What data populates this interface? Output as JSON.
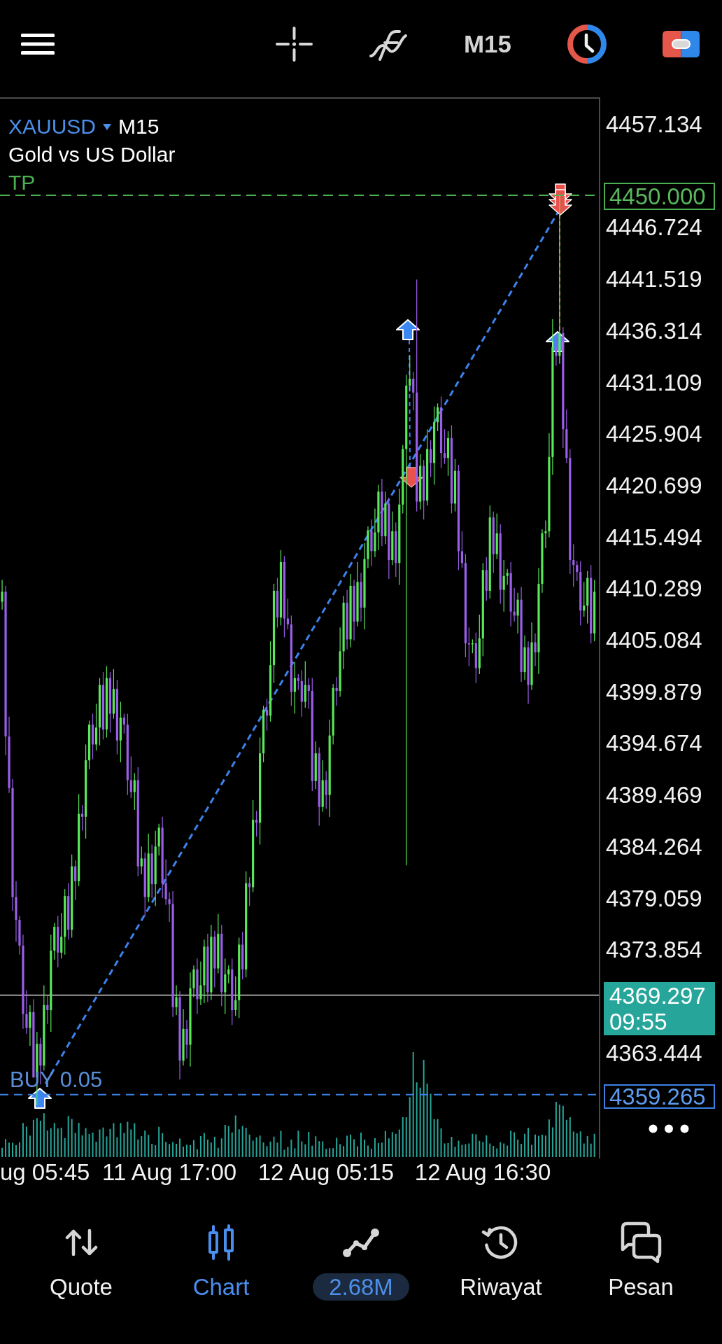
{
  "top_bar": {
    "timeframe": "M15"
  },
  "chart": {
    "symbol": "XAUUSD",
    "timeframe": "M15",
    "description": "Gold vs US Dollar",
    "take_profit_label": "TP",
    "take_profit_tag": "4450.000",
    "current_price_tag": {
      "price": "4369.297",
      "countdown": "09:55"
    },
    "order": {
      "label": "BUY 0.05",
      "price_tag": "4359.265"
    },
    "clipped_time_label": "ug 05:45",
    "chart_data": {
      "type": "candlestick",
      "categories": [
        null,
        null,
        null,
        null,
        null,
        null,
        null,
        null,
        null,
        null,
        null,
        null,
        null,
        null,
        null,
        null,
        null,
        null,
        null,
        null,
        null,
        null,
        null,
        null,
        null,
        null,
        null,
        null,
        null,
        null,
        null,
        null,
        null,
        null,
        null,
        null,
        null,
        null,
        null,
        null,
        null,
        null,
        null,
        null,
        null,
        null,
        null,
        null,
        "11 Aug 17:00",
        null,
        null,
        null,
        null,
        null,
        null,
        null,
        null,
        null,
        null,
        null,
        null,
        null,
        null,
        null,
        null,
        null,
        null,
        null,
        null,
        null,
        null,
        null,
        null,
        null,
        null,
        null,
        null,
        null,
        null,
        null,
        null,
        null,
        null,
        null,
        null,
        null,
        null,
        null,
        null,
        null,
        null,
        null,
        null,
        "12 Aug 05:15",
        null,
        null,
        null,
        null,
        null,
        null,
        null,
        null,
        null,
        null,
        null,
        null,
        null,
        null,
        null,
        null,
        null,
        null,
        null,
        null,
        null,
        null,
        null,
        null,
        null,
        null,
        null,
        null,
        null,
        null,
        null,
        null,
        null,
        null,
        null,
        null,
        null,
        null,
        null,
        null,
        null,
        null,
        null,
        null,
        "12 Aug 16:30",
        null,
        null,
        null,
        null,
        null,
        null,
        null,
        null,
        null,
        null,
        null,
        null,
        null,
        null,
        null,
        null,
        null,
        null,
        null,
        null,
        null,
        null,
        null,
        null,
        null,
        null,
        null,
        null,
        null,
        null,
        null,
        null
      ],
      "ohlc": [
        [
          4409.0,
          4411.2,
          4408.2,
          4410.0
        ],
        [
          4410.0,
          4410.6,
          4393.5,
          4395.4
        ],
        [
          4395.4,
          4397.4,
          4389.7,
          4390.2
        ],
        [
          4390.2,
          4391.1,
          4377.8,
          4379.2
        ],
        [
          4379.2,
          4380.8,
          4374.7,
          4376.9
        ],
        [
          4376.9,
          4377.3,
          4373.4,
          4374.3
        ],
        [
          4374.3,
          4375.4,
          4365.9,
          4367.4
        ],
        [
          4367.4,
          4369.8,
          4365.4,
          4366.0
        ],
        [
          4366.0,
          4368.3,
          4364.2,
          4367.6
        ],
        [
          4367.6,
          4368.9,
          4361.0,
          4361.0
        ],
        [
          4361.0,
          4365.6,
          4358.2,
          4364.4
        ],
        [
          4364.4,
          4365.0,
          4360.3,
          4362.2
        ],
        [
          4362.2,
          4370.3,
          4361.7,
          4368.3
        ],
        [
          4368.3,
          4369.2,
          4366.4,
          4367.8
        ],
        [
          4367.8,
          4375.4,
          4365.6,
          4373.8
        ],
        [
          4373.8,
          4376.6,
          4372.9,
          4376.2
        ],
        [
          4376.2,
          4377.3,
          4372.1,
          4373.6
        ],
        [
          4373.6,
          4377.6,
          4373.0,
          4375.2
        ],
        [
          4375.2,
          4380.0,
          4373.4,
          4379.3
        ],
        [
          4379.3,
          4380.6,
          4374.9,
          4375.9
        ],
        [
          4375.9,
          4383.5,
          4375.1,
          4382.3
        ],
        [
          4382.3,
          4382.9,
          4378.9,
          4380.8
        ],
        [
          4380.8,
          4389.6,
          4380.3,
          4387.6
        ],
        [
          4387.6,
          4388.5,
          4385.9,
          4387.3
        ],
        [
          4387.3,
          4394.6,
          4385.1,
          4393.0
        ],
        [
          4393.0,
          4397.0,
          4392.1,
          4396.6
        ],
        [
          4396.6,
          4397.7,
          4393.1,
          4394.6
        ],
        [
          4394.6,
          4398.7,
          4394.0,
          4396.3
        ],
        [
          4396.3,
          4401.3,
          4394.5,
          4400.6
        ],
        [
          4400.6,
          4401.9,
          4395.1,
          4396.1
        ],
        [
          4396.1,
          4402.5,
          4395.3,
          4401.3
        ],
        [
          4401.3,
          4401.9,
          4395.8,
          4397.7
        ],
        [
          4397.7,
          4402.2,
          4397.2,
          4400.2
        ],
        [
          4400.2,
          4401.1,
          4393.6,
          4395.0
        ],
        [
          4395.0,
          4398.9,
          4392.8,
          4397.3
        ],
        [
          4397.3,
          4397.7,
          4395.7,
          4396.6
        ],
        [
          4396.6,
          4397.7,
          4389.5,
          4391.0
        ],
        [
          4391.0,
          4393.4,
          4389.2,
          4389.8
        ],
        [
          4389.8,
          4391.7,
          4388.0,
          4391.0
        ],
        [
          4391.0,
          4392.3,
          4381.3,
          4382.3
        ],
        [
          4382.3,
          4384.3,
          4381.5,
          4383.1
        ],
        [
          4383.1,
          4383.7,
          4377.3,
          4379.2
        ],
        [
          4379.2,
          4385.6,
          4378.7,
          4383.6
        ],
        [
          4383.6,
          4384.5,
          4379.1,
          4380.5
        ],
        [
          4380.5,
          4385.9,
          4378.3,
          4384.3
        ],
        [
          4384.3,
          4386.6,
          4383.4,
          4386.2
        ],
        [
          4386.2,
          4387.3,
          4379.1,
          4380.6
        ],
        [
          4380.6,
          4383.0,
          4378.4,
          4379.0
        ],
        [
          4379.0,
          4379.7,
          4376.7,
          4378.5
        ],
        [
          4378.5,
          4379.8,
          4367.1,
          4368.1
        ],
        [
          4368.1,
          4370.3,
          4367.3,
          4369.1
        ],
        [
          4369.1,
          4369.7,
          4360.8,
          4362.7
        ],
        [
          4362.7,
          4367.9,
          4362.2,
          4365.9
        ],
        [
          4365.9,
          4366.8,
          4362.9,
          4364.3
        ],
        [
          4364.3,
          4371.6,
          4362.1,
          4370.0
        ],
        [
          4370.0,
          4372.3,
          4369.1,
          4371.9
        ],
        [
          4371.9,
          4373.0,
          4367.4,
          4368.9
        ],
        [
          4368.9,
          4372.7,
          4368.3,
          4370.3
        ],
        [
          4370.3,
          4374.9,
          4368.5,
          4374.2
        ],
        [
          4374.2,
          4375.5,
          4368.6,
          4369.6
        ],
        [
          4369.6,
          4376.4,
          4368.8,
          4375.2
        ],
        [
          4375.2,
          4375.8,
          4370.1,
          4372.0
        ],
        [
          4372.0,
          4377.5,
          4371.5,
          4375.5
        ],
        [
          4375.5,
          4376.4,
          4368.2,
          4369.6
        ],
        [
          4369.6,
          4373.0,
          4367.4,
          4371.4
        ],
        [
          4371.4,
          4372.3,
          4370.5,
          4371.9
        ],
        [
          4371.9,
          4373.0,
          4366.3,
          4367.8
        ],
        [
          4367.8,
          4371.2,
          4367.2,
          4368.8
        ],
        [
          4368.8,
          4375.1,
          4367.0,
          4374.4
        ],
        [
          4374.4,
          4375.7,
          4370.9,
          4371.9
        ],
        [
          4371.9,
          4381.8,
          4371.1,
          4380.6
        ],
        [
          4380.6,
          4381.2,
          4378.3,
          4380.2
        ],
        [
          4380.2,
          4389.0,
          4379.7,
          4387.0
        ],
        [
          4387.0,
          4387.9,
          4385.3,
          4386.7
        ],
        [
          4386.7,
          4395.3,
          4384.5,
          4393.7
        ],
        [
          4393.7,
          4398.5,
          4392.8,
          4398.1
        ],
        [
          4398.1,
          4399.2,
          4396.0,
          4397.5
        ],
        [
          4397.5,
          4405.0,
          4396.9,
          4402.6
        ],
        [
          4402.6,
          4410.8,
          4400.8,
          4410.1
        ],
        [
          4410.1,
          4411.4,
          4406.4,
          4407.4
        ],
        [
          4407.4,
          4414.2,
          4406.6,
          4413.0
        ],
        [
          4413.0,
          4413.6,
          4405.4,
          4407.3
        ],
        [
          4407.3,
          4409.3,
          4406.2,
          4406.7
        ],
        [
          4406.7,
          4407.6,
          4398.5,
          4399.9
        ],
        [
          4399.9,
          4402.9,
          4397.7,
          4401.3
        ],
        [
          4401.3,
          4401.7,
          4400.1,
          4401.0
        ],
        [
          4401.0,
          4402.1,
          4397.4,
          4398.9
        ],
        [
          4398.9,
          4403.0,
          4398.3,
          4400.6
        ],
        [
          4400.6,
          4401.3,
          4398.2,
          4400.0
        ],
        [
          4400.0,
          4401.3,
          4389.9,
          4390.9
        ],
        [
          4390.9,
          4394.9,
          4390.1,
          4393.7
        ],
        [
          4393.7,
          4394.3,
          4386.4,
          4388.3
        ],
        [
          4388.3,
          4393.0,
          4387.8,
          4391.0
        ],
        [
          4391.0,
          4391.9,
          4388.1,
          4389.5
        ],
        [
          4389.5,
          4397.1,
          4387.3,
          4395.5
        ],
        [
          4395.5,
          4400.7,
          4394.6,
          4400.3
        ],
        [
          4400.3,
          4401.4,
          4398.5,
          4400.0
        ],
        [
          4400.0,
          4406.4,
          4399.4,
          4404.0
        ],
        [
          4404.0,
          4409.6,
          4402.2,
          4408.9
        ],
        [
          4408.9,
          4410.2,
          4404.2,
          4405.2
        ],
        [
          4405.2,
          4411.8,
          4404.4,
          4410.6
        ],
        [
          4410.6,
          4411.2,
          4405.1,
          4407.0
        ],
        [
          4407.0,
          4413.0,
          4406.5,
          4411.0
        ],
        [
          4411.0,
          4411.9,
          4407.0,
          4408.4
        ],
        [
          4408.4,
          4414.9,
          4406.2,
          4413.3
        ],
        [
          4413.3,
          4416.6,
          4412.4,
          4416.2
        ],
        [
          4416.2,
          4417.3,
          4412.6,
          4414.1
        ],
        [
          4414.1,
          4418.4,
          4413.5,
          4416.0
        ],
        [
          4416.0,
          4420.8,
          4414.2,
          4420.1
        ],
        [
          4420.1,
          4421.4,
          4414.6,
          4415.6
        ],
        [
          4415.6,
          4420.1,
          4414.8,
          4418.9
        ],
        [
          4418.9,
          4419.5,
          4411.3,
          4413.2
        ],
        [
          4413.2,
          4418.1,
          4412.7,
          4416.1
        ],
        [
          4416.1,
          4417.0,
          4411.5,
          4412.9
        ],
        [
          4412.9,
          4420.4,
          4410.7,
          4418.8
        ],
        [
          4418.8,
          4424.8,
          4417.9,
          4424.4
        ],
        [
          4424.4,
          4431.9,
          4382.4,
          4430.8
        ],
        [
          4430.8,
          4433.9,
          4430.2,
          4431.5
        ],
        [
          4431.5,
          4432.2,
          4428.3,
          4430.1
        ],
        [
          4430.1,
          4441.5,
          4418.1,
          4419.1
        ],
        [
          4419.1,
          4423.9,
          4418.3,
          4422.7
        ],
        [
          4422.7,
          4423.3,
          4417.3,
          4419.2
        ],
        [
          4419.2,
          4426.4,
          4418.7,
          4424.4
        ],
        [
          4424.4,
          4425.3,
          4421.6,
          4423.0
        ],
        [
          4423.0,
          4428.7,
          4420.8,
          4427.1
        ],
        [
          4427.1,
          4429.0,
          4426.2,
          4428.6
        ],
        [
          4428.6,
          4429.7,
          4422.5,
          4424.0
        ],
        [
          4424.0,
          4426.4,
          4422.9,
          4423.5
        ],
        [
          4423.5,
          4426.2,
          4421.7,
          4425.5
        ],
        [
          4425.5,
          4426.8,
          4417.9,
          4418.9
        ],
        [
          4418.9,
          4423.4,
          4418.1,
          4422.2
        ],
        [
          4422.2,
          4422.8,
          4412.2,
          4414.1
        ],
        [
          4414.1,
          4416.1,
          4412.4,
          4412.9
        ],
        [
          4412.9,
          4413.8,
          4403.4,
          4404.8
        ],
        [
          4404.8,
          4406.4,
          4402.5,
          4404.7
        ],
        [
          4404.7,
          4405.2,
          4403.8,
          4404.8
        ],
        [
          4404.8,
          4405.9,
          4400.8,
          4402.3
        ],
        [
          4402.3,
          4407.7,
          4401.7,
          4405.3
        ],
        [
          4405.3,
          4412.9,
          4403.5,
          4412.2
        ],
        [
          4412.2,
          4413.5,
          4409.1,
          4410.1
        ],
        [
          4410.1,
          4418.7,
          4409.3,
          4417.5
        ],
        [
          4417.5,
          4418.1,
          4411.9,
          4413.8
        ],
        [
          4413.8,
          4417.9,
          4413.3,
          4415.9
        ],
        [
          4415.9,
          4416.8,
          4408.8,
          4410.2
        ],
        [
          4410.2,
          4413.2,
          4408.0,
          4411.6
        ],
        [
          4411.6,
          4412.3,
          4410.7,
          4411.9
        ],
        [
          4411.9,
          4413.0,
          4406.5,
          4408.0
        ],
        [
          4408.0,
          4410.4,
          4407.0,
          4407.6
        ],
        [
          4407.6,
          4409.9,
          4405.8,
          4409.2
        ],
        [
          4409.2,
          4410.5,
          4400.9,
          4401.9
        ],
        [
          4401.9,
          4405.6,
          4401.1,
          4404.4
        ],
        [
          4404.4,
          4405.0,
          4398.7,
          4400.6
        ],
        [
          4400.6,
          4406.9,
          4400.1,
          4404.9
        ],
        [
          4404.9,
          4405.8,
          4402.5,
          4403.9
        ],
        [
          4403.9,
          4412.4,
          4401.7,
          4410.8
        ],
        [
          4410.8,
          4416.3,
          4409.9,
          4415.9
        ],
        [
          4415.9,
          4417.2,
          4414.4,
          4416.1
        ],
        [
          4416.1,
          4426.0,
          4415.5,
          4423.6
        ],
        [
          4423.6,
          4437.5,
          4421.8,
          4434.7
        ],
        [
          4434.7,
          4436.0,
          4432.8,
          4433.8
        ],
        [
          4433.8,
          4450.0,
          4433.0,
          4436.1
        ],
        [
          4436.1,
          4436.7,
          4424.5,
          4426.4
        ],
        [
          4426.4,
          4428.4,
          4423.0,
          4423.5
        ],
        [
          4423.5,
          4424.4,
          4411.8,
          4413.2
        ],
        [
          4413.2,
          4414.8,
          4410.5,
          4412.7
        ],
        [
          4412.7,
          4413.1,
          4411.1,
          4412.0
        ],
        [
          4412.0,
          4413.1,
          4406.6,
          4408.1
        ],
        [
          4408.1,
          4411.0,
          4407.5,
          4408.6
        ],
        [
          4408.6,
          4412.1,
          4406.8,
          4411.4
        ],
        [
          4411.4,
          4412.7,
          4404.8,
          4405.8
        ],
        [
          4405.8,
          4411.2,
          4405.0,
          4410.0
        ]
      ],
      "ylim": [
        4352.967,
        4459.747
      ],
      "yticks": [
        {
          "value": 4457.134,
          "label": "4457.134"
        },
        {
          "value": 4446.724,
          "label": "4446.724"
        },
        {
          "value": 4441.519,
          "label": "4441.519"
        },
        {
          "value": 4436.314,
          "label": "4436.314"
        },
        {
          "value": 4431.109,
          "label": "4431.109"
        },
        {
          "value": 4425.904,
          "label": "4425.904"
        },
        {
          "value": 4420.699,
          "label": "4420.699"
        },
        {
          "value": 4415.494,
          "label": "4415.494"
        },
        {
          "value": 4410.289,
          "label": "4410.289"
        },
        {
          "value": 4405.084,
          "label": "4405.084"
        },
        {
          "value": 4399.879,
          "label": "4399.879"
        },
        {
          "value": 4394.674,
          "label": "4394.674"
        },
        {
          "value": 4389.469,
          "label": "4389.469"
        },
        {
          "value": 4384.264,
          "label": "4384.264"
        },
        {
          "value": 4379.059,
          "label": "4379.059"
        },
        {
          "value": 4373.854,
          "label": "4373.854"
        },
        {
          "value": 4363.444,
          "label": "4363.444"
        }
      ],
      "ref_lines": [
        {
          "axis": "y",
          "value": 4450.0,
          "color": "#4caf50"
        },
        {
          "axis": "y",
          "value": 4369.297,
          "color": "#9a9a9a"
        },
        {
          "axis": "y",
          "value": 4359.265,
          "color": "#3d80e4"
        }
      ]
    }
  },
  "bottom_nav": [
    {
      "label": "Quote",
      "kind": "tab",
      "selected": false
    },
    {
      "label": "Chart",
      "kind": "tab",
      "selected": true
    },
    {
      "label": "2.68M",
      "kind": "balance",
      "selected": false
    },
    {
      "label": "Riwayat",
      "kind": "tab",
      "selected": false
    },
    {
      "label": "Pesan",
      "kind": "tab",
      "selected": false
    }
  ]
}
